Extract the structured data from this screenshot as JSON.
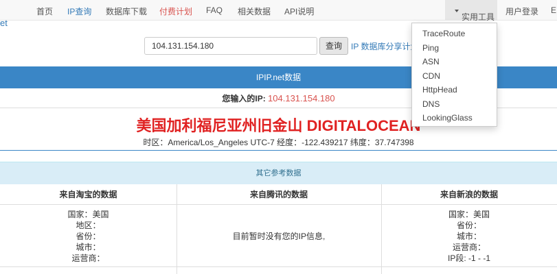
{
  "nav": {
    "brand_tail": "et",
    "items": [
      "首页",
      "IP查询",
      "数据库下载",
      "付费计划",
      "FAQ",
      "相关数据",
      "API说明"
    ],
    "tools": "实用工具",
    "login": "用户登录",
    "edge": "E"
  },
  "search": {
    "value": "104.131.154.180",
    "button": "查询",
    "share_link": "IP 数据库分享计划"
  },
  "result": {
    "panel_title": "IPIP.net数据",
    "your_ip_label": "您输入的IP: ",
    "your_ip": "104.131.154.180",
    "location": "美国加利福尼亚州旧金山 DIGITALOCEAN",
    "geo": "时区：America/Los_Angeles UTC-7 经度：-122.439217 纬度：37.747398"
  },
  "other": {
    "title": "其它参考数据",
    "columns": [
      "来自淘宝的数据",
      "来自腾讯的数据",
      "来自新浪的数据"
    ],
    "taobao": [
      "国家：美国",
      "地区：",
      "省份：",
      "城市：",
      "运营商："
    ],
    "tencent": [
      "目前暂时没有您的IP信息,"
    ],
    "sina": [
      "国家：美国",
      "省份：",
      "城市：",
      "运营商：",
      "IP段: -1 - -1"
    ]
  },
  "tools_menu": [
    "TraceRoute",
    "Ping",
    "ASN",
    "CDN",
    "HttpHead",
    "DNS",
    "LookingGlass"
  ]
}
